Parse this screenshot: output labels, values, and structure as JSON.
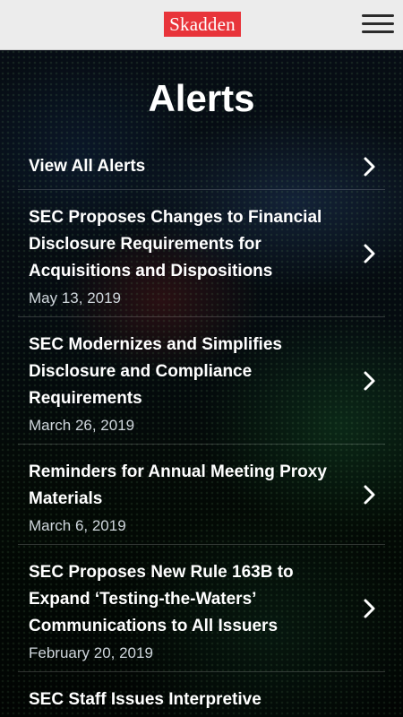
{
  "header": {
    "logo_text": "Skadden",
    "menu_icon": "hamburger-menu-icon",
    "logo_color": "#e8343a"
  },
  "page": {
    "title": "Alerts"
  },
  "alerts": [
    {
      "title": "View All Alerts",
      "date": ""
    },
    {
      "title": "SEC Proposes Changes to Financial Disclosure Requirements for Acquisitions and Dispositions",
      "date": "May 13, 2019"
    },
    {
      "title": "SEC Modernizes and Simplifies Disclosure and Compliance Requirements",
      "date": "March 26, 2019"
    },
    {
      "title": "Reminders for Annual Meeting Proxy Materials",
      "date": "March 6, 2019"
    },
    {
      "title": "SEC Proposes New Rule 163B to Expand ‘Testing-the-Waters’ Communications to All Issuers",
      "date": "February 20, 2019"
    },
    {
      "title": "SEC Staff Issues Interpretive",
      "date": ""
    }
  ],
  "icons": {
    "item_chevron": "chevron-right-icon"
  }
}
